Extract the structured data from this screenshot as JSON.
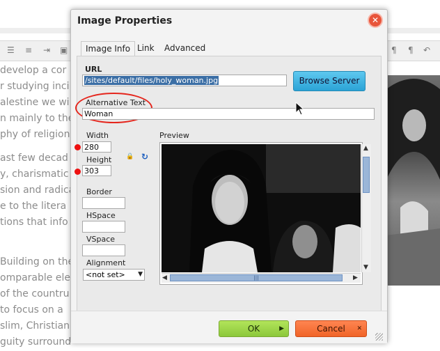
{
  "background_editor": {
    "lines": [
      "develop a cor",
      "r studying inci",
      "alestine we wi",
      "n mainly to the",
      "phy of religion",
      "ast few decad",
      "y, charismatic",
      "sion and radica",
      "e to the litera",
      "tions that info",
      "Building on the",
      "omparable ele",
      " of the countru",
      " to focus on a",
      "slim, Christian,",
      "guity surround"
    ]
  },
  "dialog": {
    "title": "Image Properties",
    "close_icon": "close-icon",
    "tabs": [
      "Image Info",
      "Link",
      "Advanced"
    ],
    "active_tab": "Image Info",
    "url": {
      "label": "URL",
      "value": "/sites/default/files/holy_woman.jpg",
      "browse_label": "Browse Server"
    },
    "alt_text": {
      "label": "Alternative Text",
      "value": "Woman"
    },
    "width": {
      "label": "Width",
      "value": "280"
    },
    "height": {
      "label": "Height",
      "value": "303"
    },
    "lock_icon": "lock-icon",
    "reset_icon": "reset-size-icon",
    "border": {
      "label": "Border",
      "value": ""
    },
    "hspace": {
      "label": "HSpace",
      "value": ""
    },
    "vspace": {
      "label": "VSpace",
      "value": ""
    },
    "alignment": {
      "label": "Alignment",
      "value": "<not set>"
    },
    "preview": {
      "label": "Preview"
    },
    "ok_label": "OK",
    "cancel_label": "Cancel"
  },
  "colors": {
    "ok_green": "#8cc83b",
    "cancel_orange": "#f06428",
    "browse_blue": "#2ba3d6",
    "close_red": "#e8543a",
    "annotation_red": "#e5261d",
    "selection_blue": "#3b6ea5"
  }
}
